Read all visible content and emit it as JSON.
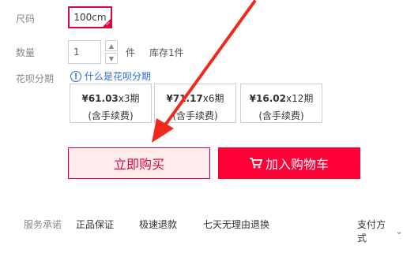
{
  "size": {
    "label": "尺码",
    "selected": "100cm"
  },
  "quantity": {
    "label": "数量",
    "value": "1",
    "unit": "件",
    "stock": "库存1件",
    "up_icon": "chevron-up",
    "down_icon": "chevron-down"
  },
  "huabei": {
    "label": "花呗分期",
    "link_text": "什么是花呗分期",
    "icon": "info-icon"
  },
  "plans": [
    {
      "amount": "¥61.03",
      "periods": "x3期",
      "fee": "(含手续费)"
    },
    {
      "amount": "¥71.17",
      "periods": "x6期",
      "fee": "(含手续费)"
    },
    {
      "amount": "¥16.02",
      "periods": "x12期",
      "fee": "(含手续费)"
    }
  ],
  "actions": {
    "buy_now": "立即购买",
    "add_cart": "加入购物车",
    "cart_icon": "cart-icon"
  },
  "service": {
    "label": "服务承诺",
    "items": [
      "正品保证",
      "极速退款",
      "七天无理由退换"
    ],
    "payment": "支付方式"
  },
  "colors": {
    "accent": "#ff0036",
    "border_selected": "#e4003a",
    "link": "#2a6dd2",
    "annotation_arrow": "#f0281e"
  }
}
